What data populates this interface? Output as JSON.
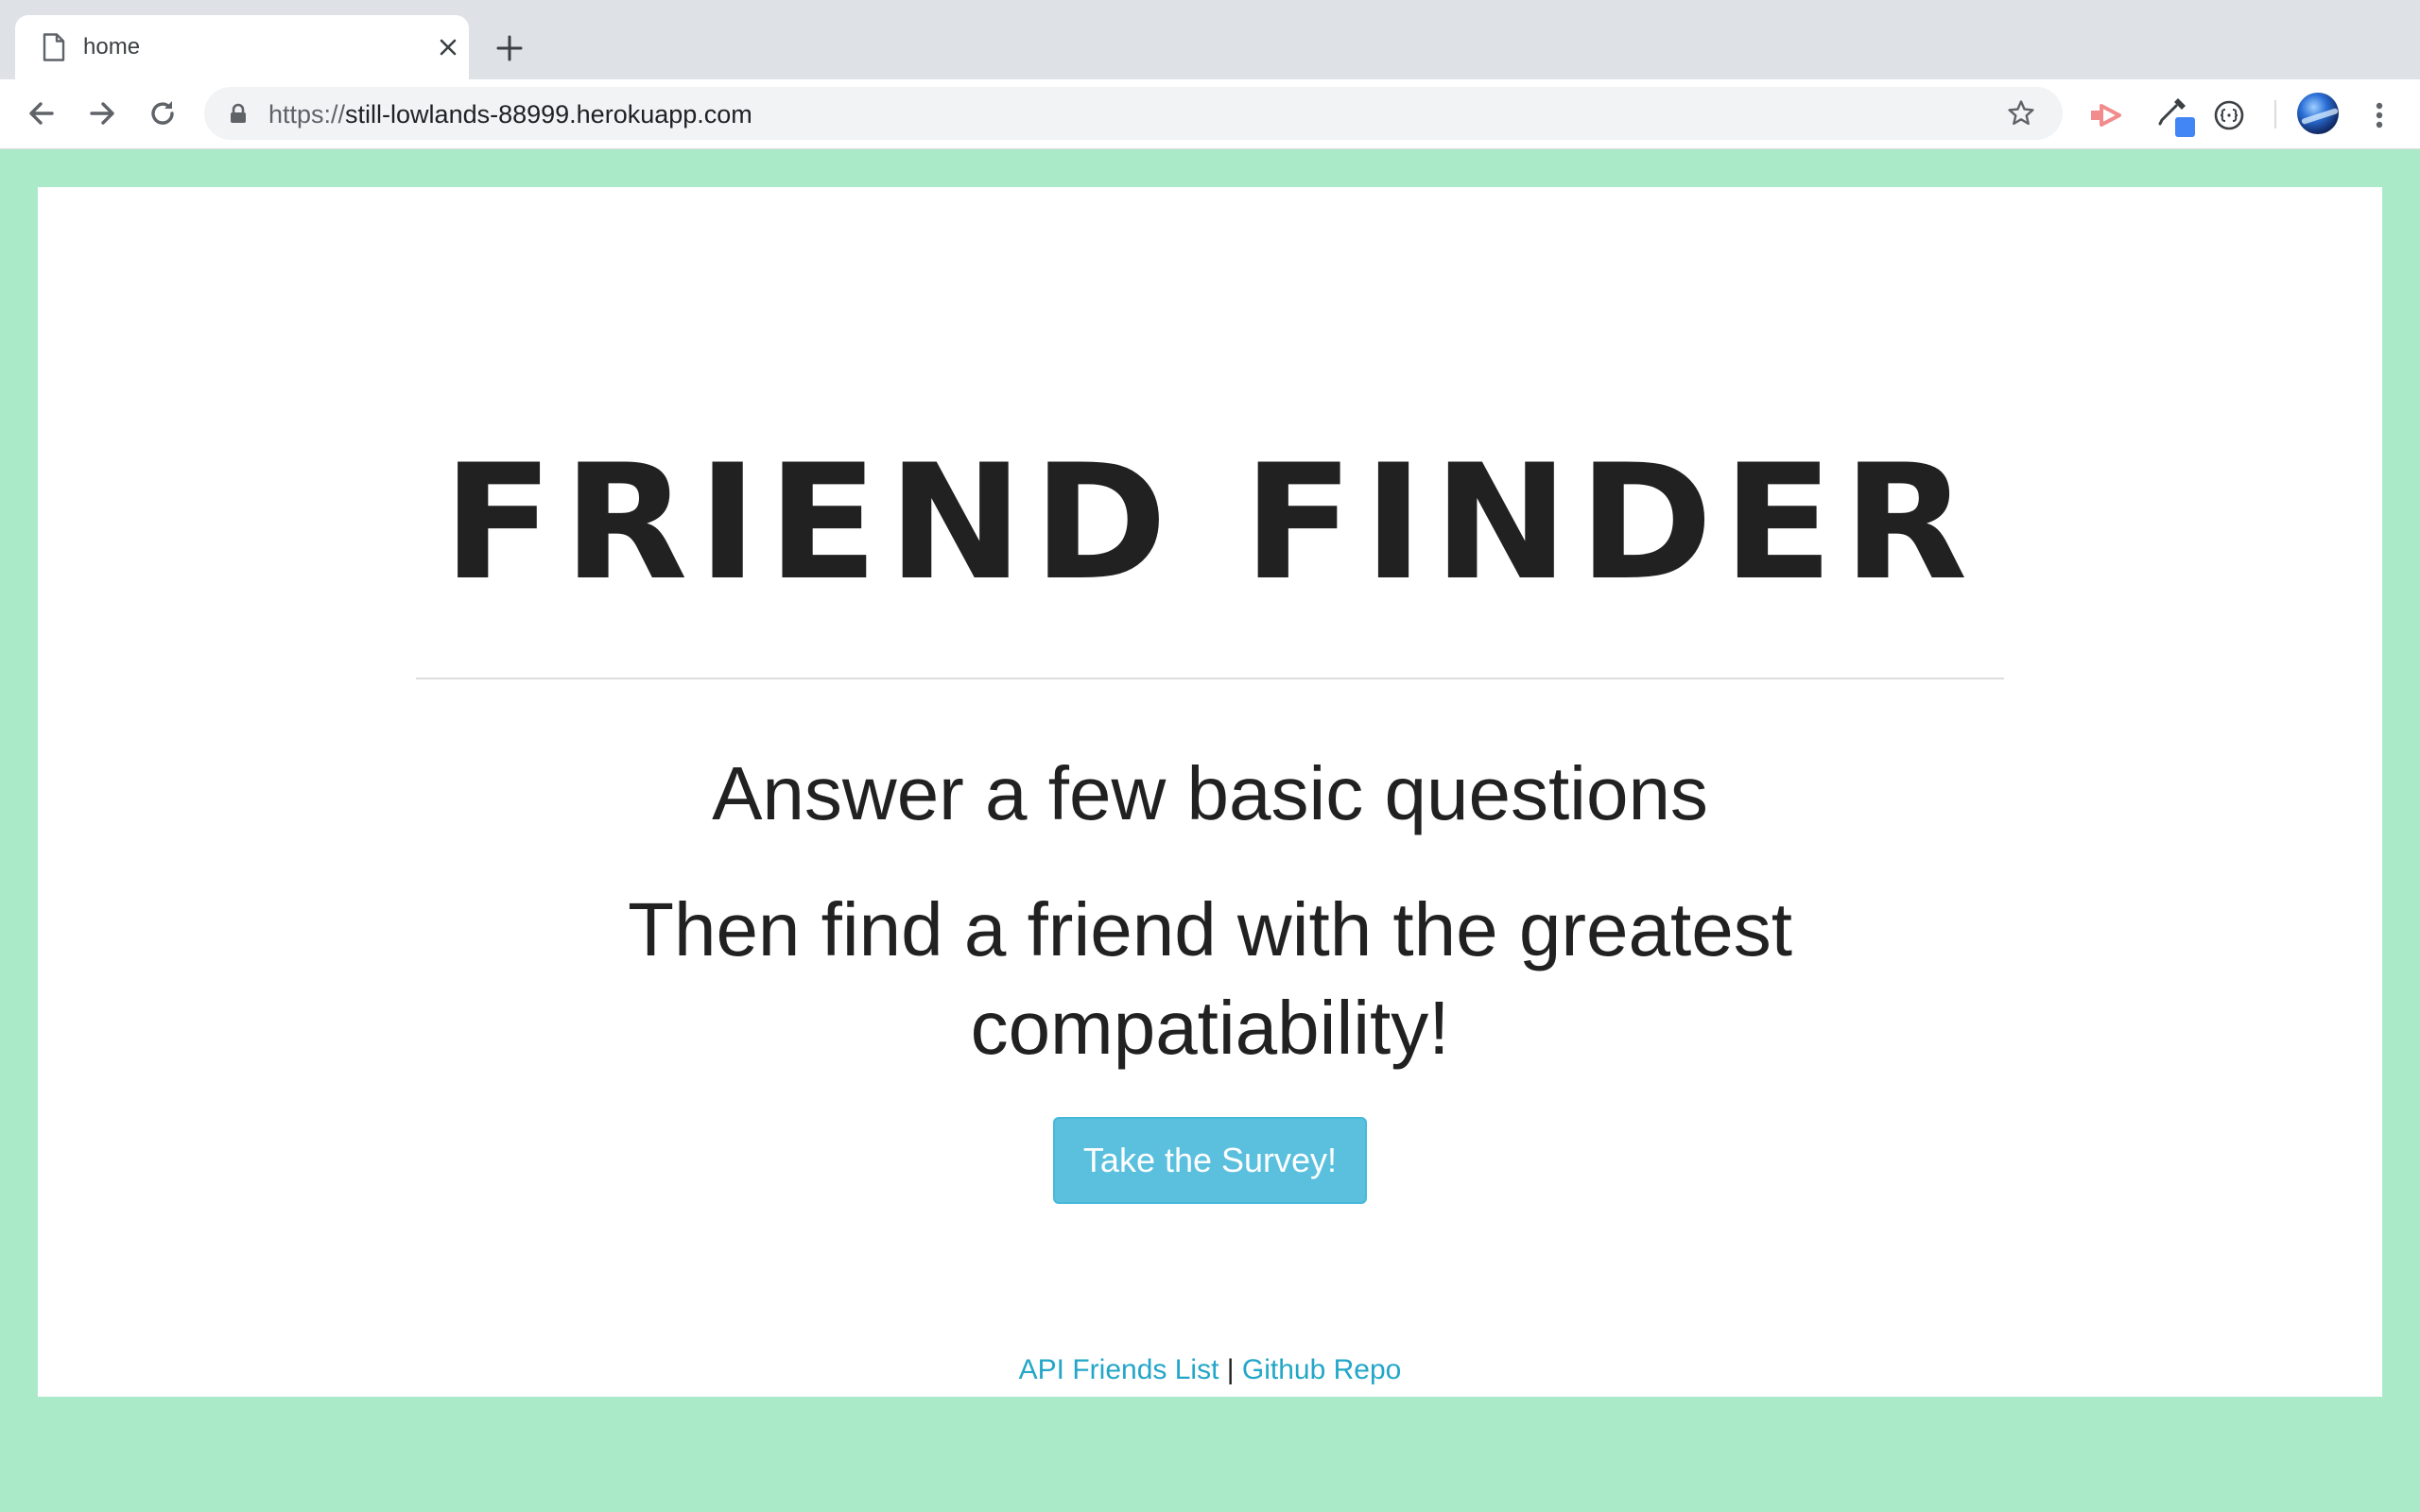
{
  "browser": {
    "tab": {
      "title": "home"
    },
    "address_bar": {
      "scheme": "https://",
      "host": "still-lowlands-88999.herokuapp.com"
    },
    "icons": {
      "tab": "document-icon",
      "close": "close-icon",
      "new_tab": "plus-icon",
      "back": "back-arrow-icon",
      "forward": "forward-arrow-icon",
      "reload": "reload-icon",
      "lock": "lock-icon",
      "bookmark": "star-icon",
      "extensions": [
        "red-extension-icon",
        "eyedropper-icon",
        "code-extension-icon"
      ],
      "profile": "avatar",
      "menu": "kebab-menu-icon"
    }
  },
  "page": {
    "title": "FRIEND FINDER",
    "lead_1": "Answer a few basic questions",
    "lead_2": "Then find a friend with the greatest compatiability!",
    "cta_label": "Take the Survey!",
    "footer": {
      "api_link": "API Friends List",
      "separator": "|",
      "repo_link": "Github Repo"
    }
  },
  "colors": {
    "background": "#aaeac8",
    "panel": "#ffffff",
    "title_text": "#212121",
    "button_bg": "#5bc0de",
    "link": "#23a6c8"
  }
}
